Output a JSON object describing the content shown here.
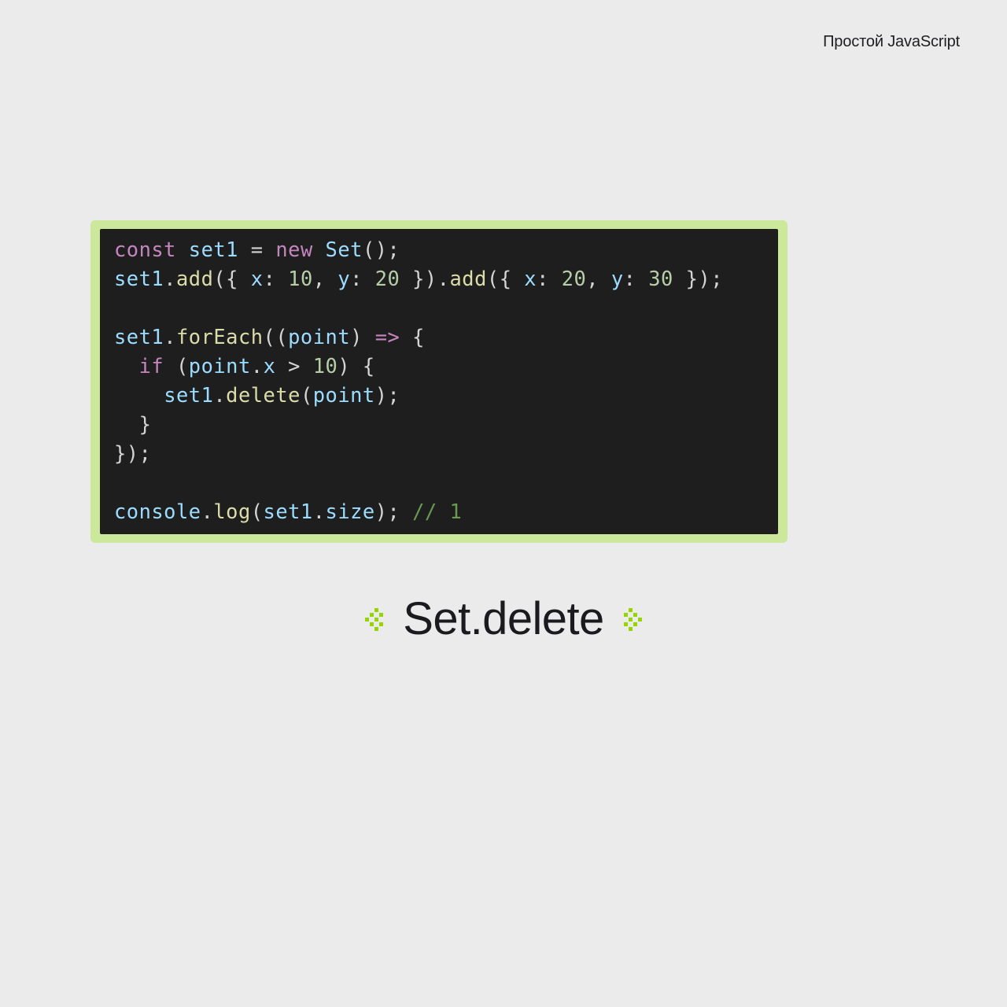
{
  "watermark": "Простой JavaScript",
  "title": "Set.delete",
  "code": {
    "line1": {
      "const": "const",
      "sp1": " ",
      "set1": "set1",
      "sp2": " ",
      "eq": "=",
      "sp3": " ",
      "new": "new",
      "sp4": " ",
      "Set": "Set",
      "parens": "();"
    },
    "line2": {
      "set1": "set1",
      "dot1": ".",
      "add1": "add",
      "p1": "({ ",
      "x1k": "x",
      "c1": ": ",
      "x1v": "10",
      "cm1": ", ",
      "y1k": "y",
      "c2": ": ",
      "y1v": "20",
      "p2": " }).",
      "add2": "add",
      "p3": "({ ",
      "x2k": "x",
      "c3": ": ",
      "x2v": "20",
      "cm2": ", ",
      "y2k": "y",
      "c4": ": ",
      "y2v": "30",
      "p4": " });"
    },
    "blank": " ",
    "line3": {
      "set1": "set1",
      "dot": ".",
      "forEach": "forEach",
      "p1": "((",
      "point": "point",
      "p2": ") ",
      "arrow": "=>",
      "p3": " {"
    },
    "line4": {
      "indent": "  ",
      "if": "if",
      "p1": " (",
      "point": "point",
      "dot": ".",
      "x": "x",
      "sp": " ",
      "gt": ">",
      "sp2": " ",
      "ten": "10",
      "p2": ") {"
    },
    "line5": {
      "indent": "    ",
      "set1": "set1",
      "dot": ".",
      "delete": "delete",
      "p1": "(",
      "point": "point",
      "p2": ");"
    },
    "line6": {
      "indent": "  ",
      "brace": "}"
    },
    "line7": {
      "close": "});"
    },
    "line8": {
      "console": "console",
      "dot": ".",
      "log": "log",
      "p1": "(",
      "set1": "set1",
      "dot2": ".",
      "size": "size",
      "p2": "); ",
      "comment": "// 1"
    }
  }
}
